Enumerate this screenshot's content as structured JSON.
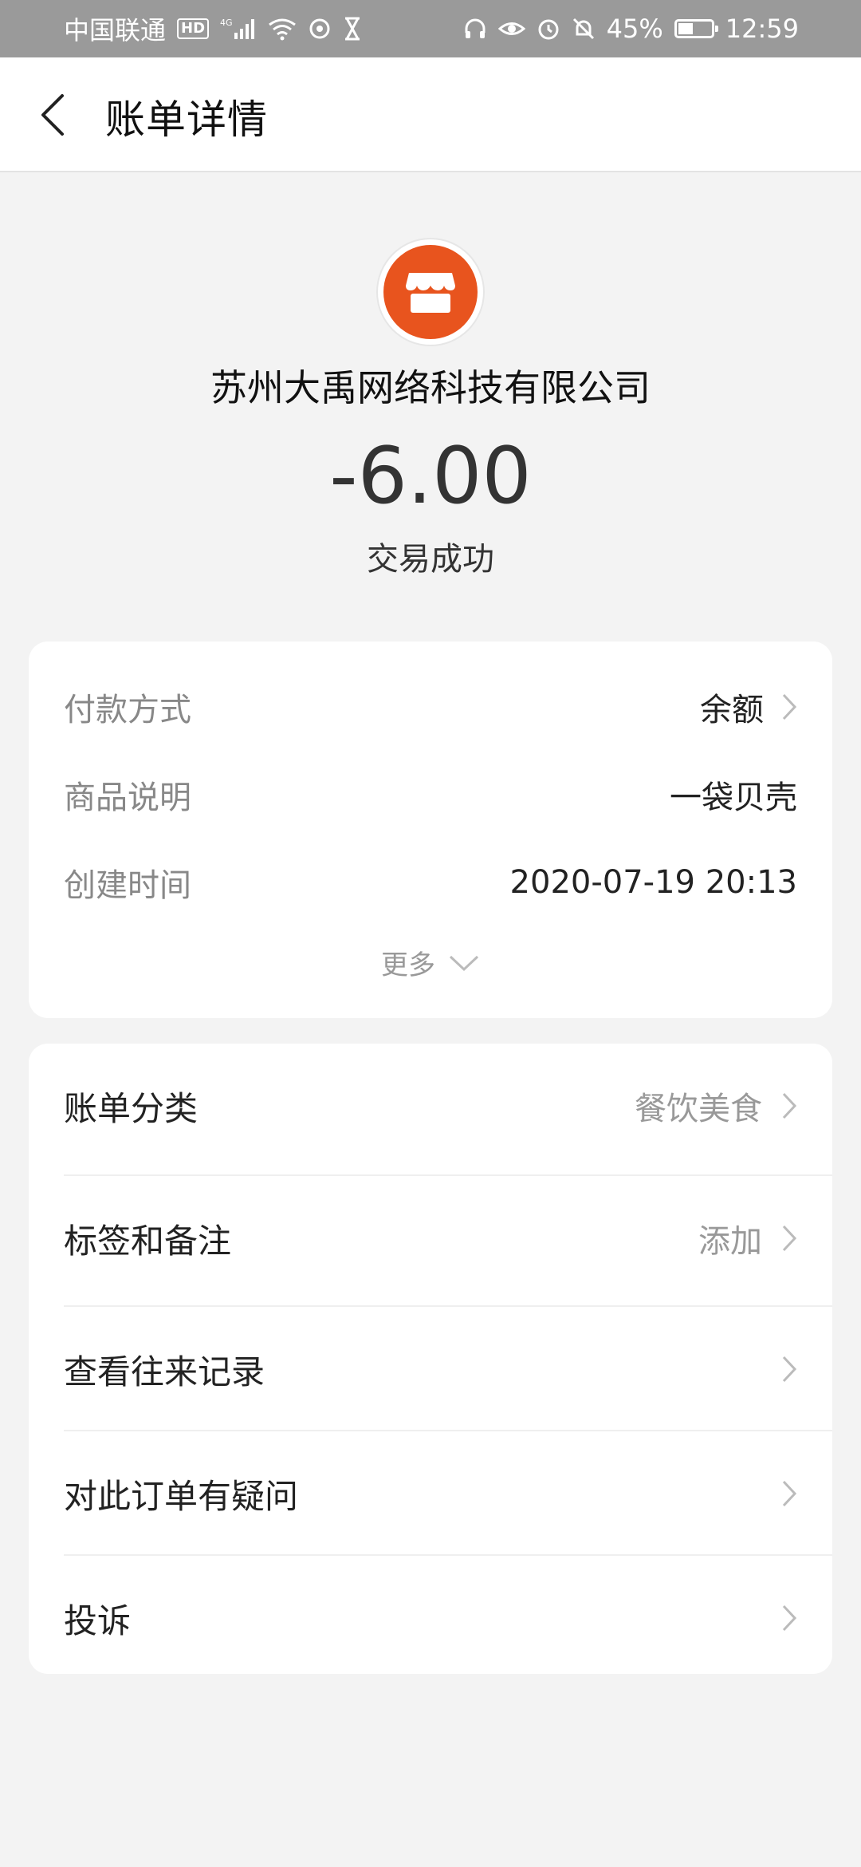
{
  "status_bar": {
    "carrier": "中国联通",
    "hd_badge": "HD",
    "network": "4G",
    "battery_percent": "45%",
    "battery_level": 0.45,
    "time": "12:59"
  },
  "nav": {
    "title": "账单详情"
  },
  "merchant": {
    "name": "苏州大禹网络科技有限公司",
    "amount": "-6.00",
    "status": "交易成功",
    "logo_color": "#e8541e"
  },
  "details": {
    "rows": [
      {
        "label": "付款方式",
        "value": "余额"
      },
      {
        "label": "商品说明",
        "value": "一袋贝壳"
      },
      {
        "label": "创建时间",
        "value": "2020-07-19 20:13"
      }
    ],
    "more_label": "更多"
  },
  "menu": {
    "items": [
      {
        "label": "账单分类",
        "value": "餐饮美食"
      },
      {
        "label": "标签和备注",
        "value": "添加"
      },
      {
        "label": "查看往来记录",
        "value": ""
      },
      {
        "label": "对此订单有疑问",
        "value": ""
      },
      {
        "label": "投诉",
        "value": ""
      }
    ]
  }
}
